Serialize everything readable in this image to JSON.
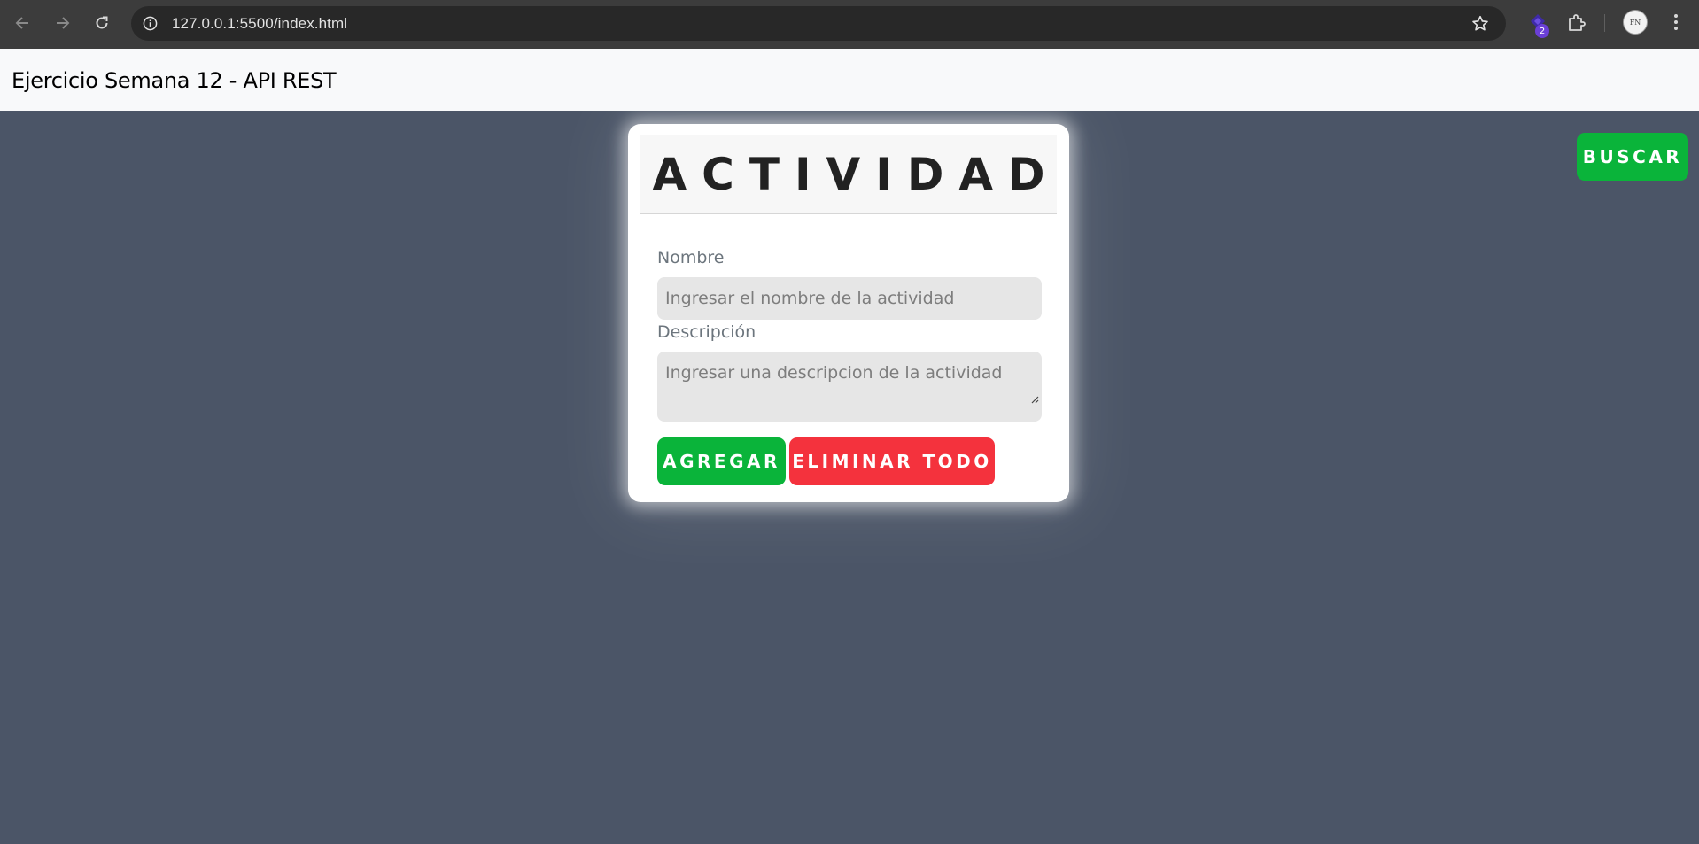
{
  "browser": {
    "url": "127.0.0.1:5500/index.html",
    "extension_badge": "2",
    "avatar_text": "FN"
  },
  "navbar": {
    "brand": "Ejercicio Semana 12 - API REST"
  },
  "search_button": {
    "label": "BUSCAR"
  },
  "form": {
    "title": "ACTIVIDAD",
    "name_label": "Nombre",
    "name_placeholder": "Ingresar el nombre de la actividad",
    "name_value": "",
    "description_label": "Descripción",
    "description_placeholder": "Ingresar una descripcion de la actividad",
    "description_value": "",
    "add_button": "AGREGAR",
    "delete_all_button": "ELIMINAR TODO"
  },
  "colors": {
    "background": "#4b5567",
    "green": "#0ab43a",
    "red": "#f4323d",
    "navbar": "#f8f9fa"
  }
}
